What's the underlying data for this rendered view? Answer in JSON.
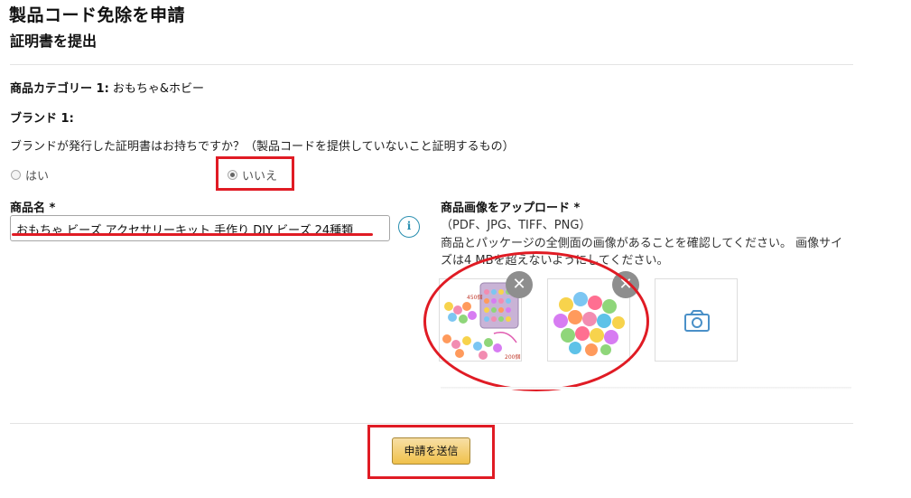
{
  "header": {
    "title": "製品コード免除を申請",
    "subtitle": "証明書を提出"
  },
  "category": {
    "label": "商品カテゴリー 1:",
    "value": "おもちゃ&ホビー"
  },
  "brand": {
    "label": "ブランド 1:",
    "value": ""
  },
  "certificate": {
    "question": "ブランドが発行した証明書はお持ちですか？（製品コードを提供していないこと証明するもの）",
    "options": [
      "はい",
      "いいえ"
    ],
    "selected": "いいえ"
  },
  "product_name": {
    "label": "商品名 *",
    "value": "おもちゃ ビーズ アクセサリーキット 手作り DIY ビーズ 24種類",
    "info_icon": "i"
  },
  "upload": {
    "label": "商品画像をアップロード *",
    "formats": "（PDF、JPG、TIFF、PNG）",
    "description_line1": "商品とパッケージの全側面の画像があることを確認してください。 画像サイ",
    "description_line2": "ズは4 MBを超えないようにしてください。",
    "remove_glyph": "✕",
    "thumb1_labels": [
      "450個",
      "200個"
    ]
  },
  "submit": {
    "label": "申請を送信"
  },
  "colors": {
    "accent_red": "#e01b24",
    "button_yellow": "#f0c14b",
    "info_blue": "#2a8fb0"
  },
  "icons": [
    "info-icon",
    "close-icon",
    "camera-icon"
  ]
}
